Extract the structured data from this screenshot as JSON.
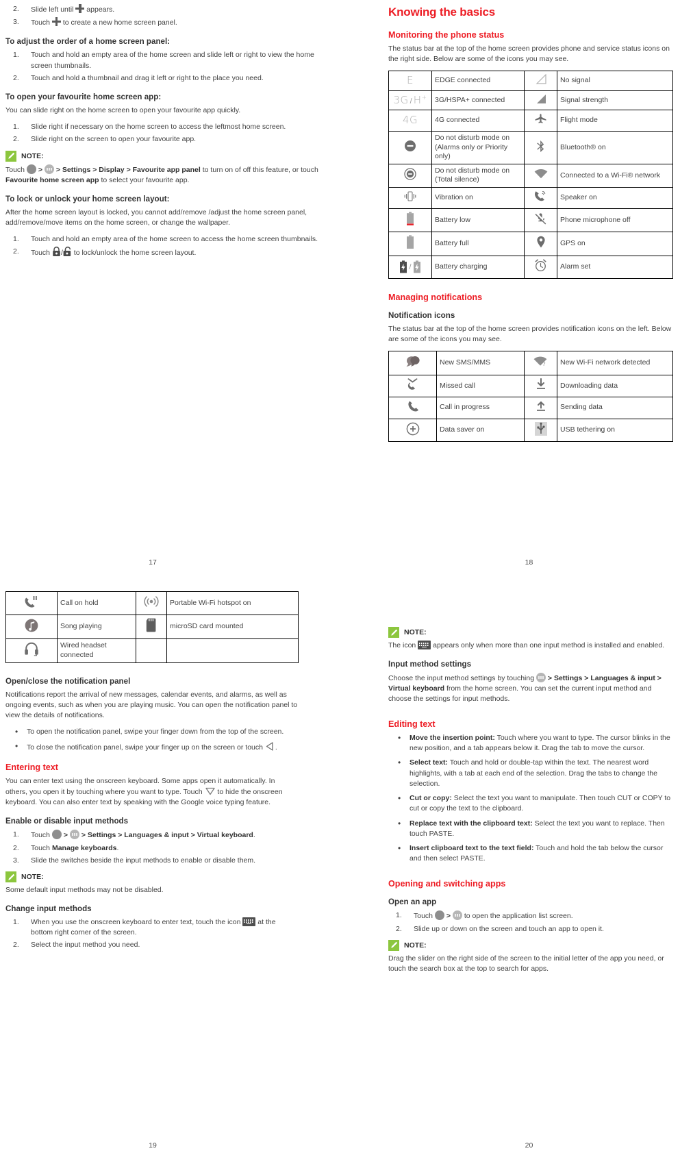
{
  "accent": {
    "red": "#ed1c24",
    "green": "#8cc63e",
    "text": "#414141"
  },
  "page17": {
    "number": "17",
    "steps_top": [
      {
        "n": "2.",
        "pre": "Slide left until",
        "icon": "plus-icon",
        "post": "appears."
      },
      {
        "n": "3.",
        "pre": "Touch",
        "icon": "plus-icon",
        "post": "to create a new home screen panel."
      }
    ],
    "sec_order_title": "To adjust the order of a home screen panel:",
    "sec_order_steps": [
      {
        "n": "1.",
        "text": "Touch and hold an empty area of the home screen and slide left or right to view the home screen thumbnails."
      },
      {
        "n": "2.",
        "text": "Touch and hold a thumbnail and drag it left or right to the place you need."
      }
    ],
    "sec_fav_title": "To open your favourite home screen app:",
    "sec_fav_intro": "You can slide right on the home screen to open your favourite app quickly.",
    "sec_fav_steps": [
      {
        "n": "1.",
        "text": "Slide right if necessary on the home screen to access the leftmost home screen."
      },
      {
        "n": "2.",
        "text": "Slide right on the screen to open your favourite app."
      }
    ],
    "note_label": "NOTE:",
    "note_fav": {
      "p1": "Touch",
      "gt1": ">",
      "gt2": "> Settings > Display > Favourite app panel",
      "p2": "to turn on of off this feature, or touch",
      "b2": "Favourite home screen app",
      "p3": "to select your favourite app."
    },
    "sec_lock_title": "To lock or unlock your home screen layout:",
    "sec_lock_intro": "After the home screen layout is locked, you cannot add/remove /adjust the home screen panel, add/remove/move items on the home screen, or change the wallpaper.",
    "sec_lock_steps": [
      {
        "n": "1.",
        "text": "Touch and hold an empty area of the home screen to access the home screen thumbnails."
      }
    ],
    "sec_lock_step2": {
      "n": "2.",
      "pre": "Touch",
      "post": "to lock/unlock the home screen layout."
    }
  },
  "page18": {
    "number": "18",
    "title": "Knowing the basics",
    "h_monitor": "Monitoring the phone status",
    "p_monitor": "The status bar at the top of the home screen provides phone and service status icons on the right side. Below are some of the icons you may see.",
    "status_table": [
      {
        "icon1": "edge-icon",
        "text1": "EDGE connected",
        "icon2": "no-signal-icon",
        "text2": "No signal"
      },
      {
        "icon1": "3g-hsdpa-icon",
        "text1": "3G/HSPA+ connected",
        "icon2": "signal-strength-icon",
        "text2": "Signal strength"
      },
      {
        "icon1": "4g-icon",
        "text1": "4G connected",
        "icon2": "flight-mode-icon",
        "text2": "Flight mode"
      },
      {
        "icon1": "dnd-alarms-icon",
        "text1": "Do not disturb mode on (Alarms only or Priority only)",
        "icon2": "bluetooth-icon",
        "text2": "Bluetooth® on"
      },
      {
        "icon1": "dnd-total-icon",
        "text1": "Do not disturb mode on (Total silence)",
        "icon2": "wifi-icon",
        "text2": "Connected to a Wi-Fi® network"
      },
      {
        "icon1": "vibration-icon",
        "text1": "Vibration on",
        "icon2": "speaker-icon",
        "text2": "Speaker on"
      },
      {
        "icon1": "battery-low-icon",
        "text1": "Battery low",
        "icon2": "mic-off-icon",
        "text2": "Phone microphone off"
      },
      {
        "icon1": "battery-full-icon",
        "text1": "Battery full",
        "icon2": "gps-icon",
        "text2": "GPS on"
      },
      {
        "icon1": "battery-charging-icon",
        "text1": "Battery charging",
        "icon2": "alarm-icon",
        "text2": "Alarm set"
      }
    ],
    "h_managing": "Managing notifications",
    "h_notif_icons": "Notification icons",
    "p_notif": "The status bar at the top of the home screen provides notification icons on the left. Below are some of the icons you may see.",
    "notif_table": [
      {
        "icon1": "sms-icon",
        "text1": "New SMS/MMS",
        "icon2": "new-wifi-icon",
        "text2": "New Wi-Fi network detected"
      },
      {
        "icon1": "missed-call-icon",
        "text1": "Missed call",
        "icon2": "download-icon",
        "text2": "Downloading data"
      },
      {
        "icon1": "call-icon",
        "text1": "Call in progress",
        "icon2": "upload-icon",
        "text2": "Sending data"
      },
      {
        "icon1": "data-saver-icon",
        "text1": "Data saver on",
        "icon2": "usb-tethering-icon",
        "text2": "USB tethering on"
      }
    ]
  },
  "page19": {
    "number": "19",
    "notif_table2": [
      {
        "icon1": "call-hold-icon",
        "text1": "Call on hold",
        "icon2": "hotspot-icon",
        "text2": "Portable Wi-Fi hotspot on"
      },
      {
        "icon1": "song-playing-icon",
        "text1": "Song playing",
        "icon2": "microsd-icon",
        "text2": "microSD card mounted"
      },
      {
        "icon1": "wired-headset-icon",
        "text1": "Wired headset connected",
        "icon2": "",
        "text2": ""
      }
    ],
    "h_panel": "Open/close the notification panel",
    "p_panel": "Notifications report the arrival of new messages, calendar events, and alarms, as well as ongoing events, such as when you are playing music. You can open the notification panel to view the details of notifications.",
    "panel_bullets": [
      {
        "text": "To open the notification panel, swipe your finger down from the top of the screen."
      }
    ],
    "panel_bullet2": {
      "pre": "To close the notification panel, swipe your finger up on the screen or touch",
      "icon": "back-icon",
      "post": "."
    },
    "h_entering": "Entering text",
    "p_entering_a": "You can enter text using the onscreen keyboard. Some apps open it automatically. In others, you open it by touching where you want to type. Touch",
    "p_entering_b": "to hide the onscreen keyboard. You can also enter text by speaking with the Google voice typing feature.",
    "h_enable": "Enable or disable input methods",
    "enable_step1": {
      "n": "1.",
      "pre": "Touch",
      "gt": ">",
      "bold": "> Settings > Languages & input > Virtual keyboard",
      "post": "."
    },
    "enable_steps": [
      {
        "n": "2.",
        "pre": "Touch",
        "bold": "Manage keyboards",
        "post": "."
      },
      {
        "n": "3.",
        "pre": "Slide the switches beside the input methods to enable or disable them.",
        "bold": "",
        "post": ""
      }
    ],
    "note_label": "NOTE:",
    "note_default": "Some default input methods may not be disabled.",
    "h_change": "Change input methods",
    "change_step1": {
      "n": "1.",
      "pre": "When you use the onscreen keyboard to enter text, touch the icon",
      "post": "at the bottom right corner of the screen."
    },
    "change_step2": {
      "n": "2.",
      "text": "Select the input method you need."
    }
  },
  "page20": {
    "number": "20",
    "note_label": "NOTE:",
    "note_kbd": {
      "pre": "The icon",
      "post": "appears only when more than one input method is installed and enabled."
    },
    "h_ims": "Input method settings",
    "p_ims": {
      "pre": "Choose the input method settings by touching",
      "bold": "> Settings > Languages & input > Virtual keyboard",
      "post": "from the home screen. You can set the current input method and choose the settings for input methods."
    },
    "h_editing": "Editing text",
    "editing_bullets": [
      {
        "bold": "Move the insertion point:",
        "text": " Touch where you want to type. The cursor blinks in the new position, and a tab appears below it. Drag the tab to move the cursor."
      },
      {
        "bold": "Select text:",
        "text": " Touch and hold or double-tap within the text. The nearest word highlights, with a tab at each end of the selection. Drag the tabs to change the selection."
      },
      {
        "bold": "Cut or copy:",
        "text": " Select the text you want to manipulate. Then touch CUT or COPY to cut or copy the text to the clipboard."
      },
      {
        "bold": "Replace text with the clipboard text:",
        "text": " Select the text you want to replace. Then touch PASTE."
      },
      {
        "bold": "Insert clipboard text to the text field:",
        "text": " Touch and hold the tab below the cursor and then select PASTE."
      }
    ],
    "h_opening": "Opening and switching apps",
    "h_openapp": "Open an app",
    "open_step1": {
      "n": "1.",
      "pre": "Touch",
      "gt": ">",
      "post": "to open the application list screen."
    },
    "open_step2": {
      "n": "2.",
      "text": "Slide up or down on the screen and touch an app to open it."
    },
    "note_slider": "Drag the slider on the right side of the screen to the initial letter of the app you need, or touch the search box at the top to search for apps."
  }
}
